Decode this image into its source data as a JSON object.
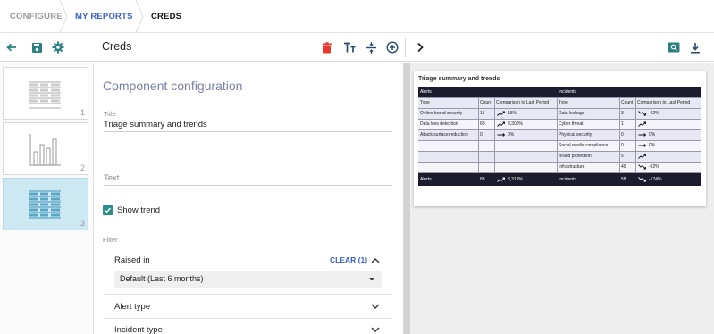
{
  "breadcrumb": [
    "CONFIGURE",
    "MY REPORTS",
    "CREDS"
  ],
  "toolbar": {
    "title": "Creds",
    "icons": [
      "arrow-back-icon",
      "save-icon",
      "gear-icon",
      "delete-icon",
      "text-size-icon",
      "divide-icon",
      "add-circle-icon",
      "chevron-right-icon",
      "image-search-icon",
      "download-icon"
    ],
    "delete_color": "#e8382d",
    "accent_color": "#2a7e84"
  },
  "thumbnails": [
    {
      "number": "1",
      "icon": "table-icon"
    },
    {
      "number": "2",
      "icon": "bar-chart-icon"
    },
    {
      "number": "3",
      "icon": "table-icon",
      "selected": true
    }
  ],
  "config": {
    "heading": "Component configuration",
    "title_label": "Title",
    "title_value": "Triage summary and trends",
    "text_placeholder": "Text",
    "show_trend_label": "Show trend",
    "show_trend_checked": true,
    "filter_label": "Filter",
    "raised_in_label": "Raised in",
    "clear_label": "CLEAR (1)",
    "raised_in_value": "Default (Last 6 months)",
    "alert_type_label": "Alert type",
    "incident_type_label": "Incident type"
  },
  "preview": {
    "title": "Triage summary and trends",
    "alerts_header": "Alerts",
    "incidents_header": "Incidents",
    "columns": {
      "type": "Type",
      "count": "Count",
      "comparison": "Comparison to Last Period"
    },
    "alerts_rows": [
      {
        "type": "Online brand security",
        "count": "15",
        "comparison": "15%",
        "trend": "up"
      },
      {
        "type": "Data loss detection",
        "count": "68",
        "comparison": "3,300%",
        "trend": "up"
      },
      {
        "type": "Attack surface reduction",
        "count": "0",
        "comparison": "0%",
        "trend": "flat"
      }
    ],
    "incidents_rows": [
      {
        "type": "Data leakage",
        "count": "3",
        "comparison": "-92%",
        "trend": "down"
      },
      {
        "type": "Cyber threat",
        "count": "1",
        "comparison": "",
        "trend": "up"
      },
      {
        "type": "Physical security",
        "count": "0",
        "comparison": "0%",
        "trend": "flat"
      },
      {
        "type": "Social media compliance",
        "count": "0",
        "comparison": "0%",
        "trend": "flat"
      },
      {
        "type": "Brand protection",
        "count": "5",
        "comparison": "",
        "trend": "up"
      },
      {
        "type": "Infrastructure",
        "count": "49",
        "comparison": "-82%",
        "trend": "down"
      }
    ],
    "alerts_total": {
      "type": "Alerts",
      "count": "83",
      "comparison": "3,319%",
      "trend": "up"
    },
    "incidents_total": {
      "type": "Incidents",
      "count": "58",
      "comparison": "-174%",
      "trend": "down"
    },
    "header_color": "#1c1c2e",
    "row_color": "#e8e8f4"
  }
}
